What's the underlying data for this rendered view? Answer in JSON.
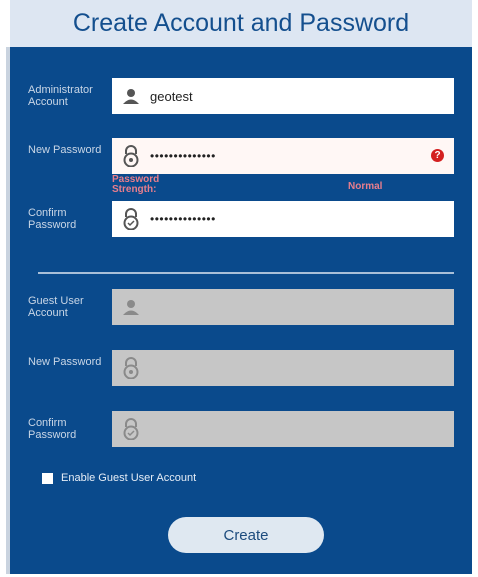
{
  "header": {
    "title": "Create Account and Password"
  },
  "admin": {
    "account_label": "Administrator Account",
    "account_value": "geotest",
    "password_label": "New Password",
    "password_value": "••••••••••••••",
    "help_icon": "question-icon",
    "strength_label": "Password Strength:",
    "strength_value": "Normal",
    "confirm_label": "Confirm Password",
    "confirm_value": "••••••••••••••"
  },
  "guest": {
    "account_label": "Guest User Account",
    "account_value": "",
    "password_label": "New Password",
    "confirm_label": "Confirm Password"
  },
  "enable_guest": {
    "label": "Enable Guest User Account",
    "checked": false
  },
  "create_button": {
    "label": "Create"
  },
  "colors": {
    "panel": "#0a4a8c",
    "header_bg": "#dde6f2",
    "title": "#144f8e",
    "strength": "#e87e8c",
    "disabled_field": "#c6c6c6",
    "error": "#d42020"
  }
}
